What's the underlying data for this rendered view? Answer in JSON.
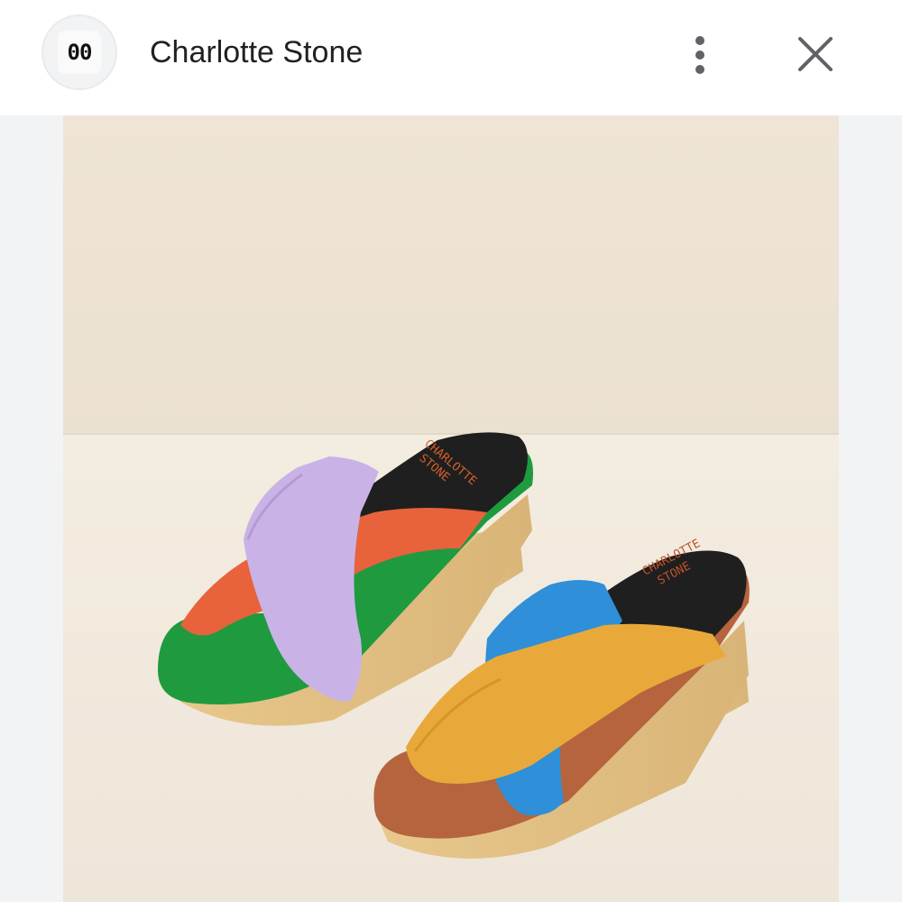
{
  "header": {
    "avatar_text": "00",
    "title": "Charlotte Stone",
    "more_icon": "more-vert-icon",
    "close_icon": "close-icon"
  },
  "image": {
    "sole_stamp_line1": "CHARLOTTE",
    "sole_stamp_line2": "STONE"
  },
  "colors": {
    "wall": "#ede4d9",
    "floor": "#f2ebe0",
    "lavender": "#c9b3e6",
    "orange": "#e8623c",
    "green": "#1f9a3f",
    "blue": "#2f8fd8",
    "mustard": "#e9a93a",
    "tan_sole": "#b5643e",
    "wood": "#e6c68c"
  }
}
